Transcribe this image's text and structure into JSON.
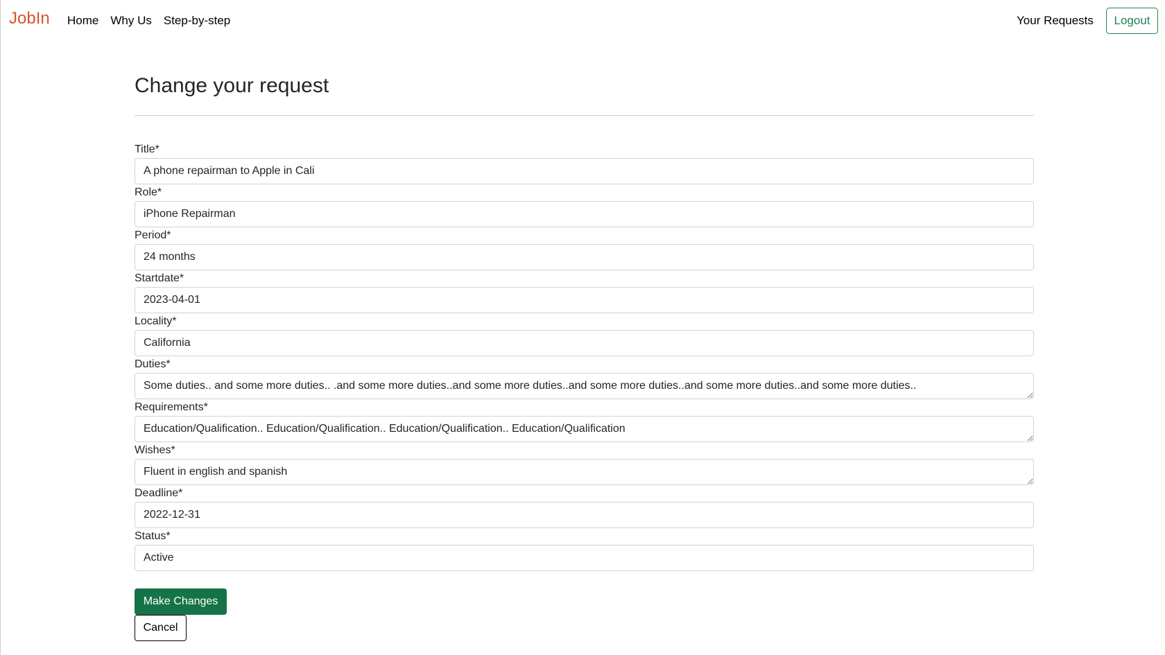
{
  "navbar": {
    "brand": "JobIn",
    "links": [
      {
        "label": "Home"
      },
      {
        "label": "Why Us"
      },
      {
        "label": "Step-by-step"
      }
    ],
    "right_link": "Your Requests",
    "logout_label": "Logout"
  },
  "page": {
    "title": "Change your request"
  },
  "form": {
    "fields": [
      {
        "label": "Title*",
        "value": "A phone repairman to Apple in Cali"
      },
      {
        "label": "Role*",
        "value": "iPhone Repairman"
      },
      {
        "label": "Period*",
        "value": "24 months"
      },
      {
        "label": "Startdate*",
        "value": "2023-04-01"
      },
      {
        "label": "Locality*",
        "value": "California"
      },
      {
        "label": "Duties*",
        "value": "Some duties.. and some more duties.. .and some more duties..and some more duties..and some more duties..and some more duties..and some more duties.."
      },
      {
        "label": "Requirements*",
        "value": "Education/Qualification.. Education/Qualification.. Education/Qualification.. Education/Qualification"
      },
      {
        "label": "Wishes*",
        "value": "Fluent in english and spanish"
      },
      {
        "label": "Deadline*",
        "value": "2022-12-31"
      },
      {
        "label": "Status*",
        "value": "Active"
      }
    ],
    "submit_label": "Make Changes",
    "cancel_label": "Cancel"
  },
  "colors": {
    "brand": "#d9532b",
    "primary_green": "#157347",
    "outline_green": "#198754"
  }
}
